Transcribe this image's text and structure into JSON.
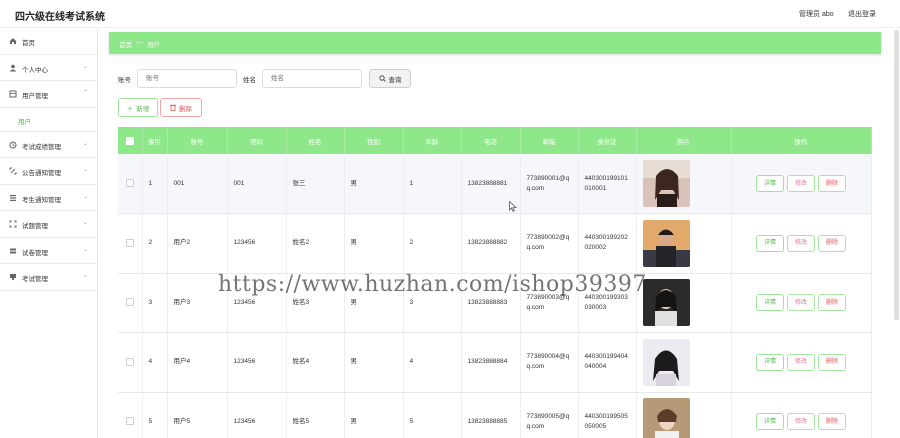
{
  "header": {
    "app_title": "四六级在线考试系统",
    "admin_label": "管理员 abo",
    "logout_label": "退出登录"
  },
  "sidebar": {
    "items": [
      {
        "label": "首页",
        "icon": "home-icon",
        "has_chevron": false
      },
      {
        "label": "个人中心",
        "icon": "user-icon",
        "has_chevron": true
      },
      {
        "label": "用户管理",
        "icon": "users-icon",
        "has_chevron": true,
        "expanded": true
      },
      {
        "label": "考试成绩管理",
        "icon": "score-icon",
        "has_chevron": true
      },
      {
        "label": "公告通知管理",
        "icon": "notice-icon",
        "has_chevron": true
      },
      {
        "label": "考生通知管理",
        "icon": "list-icon",
        "has_chevron": true
      },
      {
        "label": "试题管理",
        "icon": "question-icon",
        "has_chevron": true
      },
      {
        "label": "试卷管理",
        "icon": "paper-icon",
        "has_chevron": true
      },
      {
        "label": "考试管理",
        "icon": "exam-icon",
        "has_chevron": true
      }
    ],
    "sub_item": "用户"
  },
  "breadcrumb": {
    "home": "首页",
    "separator": "—",
    "current": "用户"
  },
  "filters": {
    "account_label": "账号",
    "account_placeholder": "账号",
    "name_label": "姓名",
    "name_placeholder": "姓名",
    "query_button": "查询"
  },
  "actions": {
    "add": "新增",
    "delete": "删除"
  },
  "table": {
    "columns": [
      "索引",
      "账号",
      "密码",
      "姓名",
      "性别",
      "年龄",
      "电话",
      "邮箱",
      "身份证",
      "照片",
      "操作"
    ],
    "rows": [
      {
        "index": "1",
        "account": "001",
        "password": "001",
        "name": "张三",
        "gender": "男",
        "age": "1",
        "phone": "13823888881",
        "email": "773890001@qq.com",
        "idcard": "440300199101010001"
      },
      {
        "index": "2",
        "account": "用户2",
        "password": "123456",
        "name": "姓名2",
        "gender": "男",
        "age": "2",
        "phone": "13823888882",
        "email": "773890002@qq.com",
        "idcard": "440300199202020002"
      },
      {
        "index": "3",
        "account": "用户3",
        "password": "123456",
        "name": "姓名3",
        "gender": "男",
        "age": "3",
        "phone": "13823888883",
        "email": "773890003@qq.com",
        "idcard": "440300199303030003"
      },
      {
        "index": "4",
        "account": "用户4",
        "password": "123456",
        "name": "姓名4",
        "gender": "男",
        "age": "4",
        "phone": "13823888884",
        "email": "773890004@qq.com",
        "idcard": "440300199404040004"
      },
      {
        "index": "5",
        "account": "用户5",
        "password": "123456",
        "name": "姓名5",
        "gender": "男",
        "age": "5",
        "phone": "13823888885",
        "email": "773890005@qq.com",
        "idcard": "440300199505050005"
      }
    ],
    "row_actions": {
      "detail": "详情",
      "edit": "修改",
      "delete": "删除"
    }
  },
  "watermark": "https://www.huzhan.com/ishop39397",
  "colors": {
    "accent": "#8ee88a",
    "accent_text": "#4fb84f",
    "danger": "#e05555"
  }
}
